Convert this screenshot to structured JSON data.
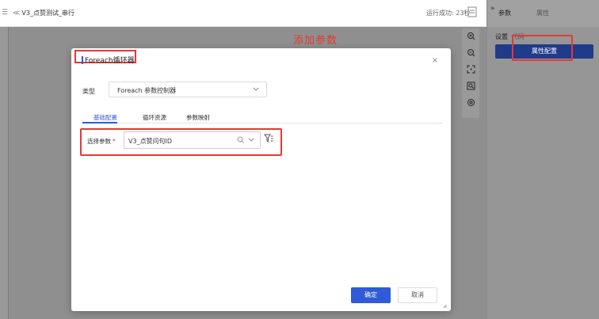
{
  "header": {
    "left_icon": "panel-icon",
    "back_symbol": "≪",
    "title": "V3_点赞测试_串行",
    "status": "运行成功: 23秒"
  },
  "annotation": {
    "text": "添加参数",
    "color": "#e53935"
  },
  "zoom_toolbar": {
    "icons": [
      "zoom-in-icon",
      "zoom-out-icon",
      "fit-screen-icon",
      "zoom-area-icon",
      "locate-icon"
    ]
  },
  "right_panel": {
    "collapse_symbol": "»",
    "tabs": [
      "参数",
      "属性"
    ],
    "setting_label": "设置",
    "setting_sub": " 代码",
    "button_label": "属性配置"
  },
  "dialog": {
    "title": "Foreach循环器",
    "close_symbol": "×",
    "type_label": "类型",
    "type_value": "Foreach 参数控制器",
    "tabs": [
      "基础配置",
      "循环资源",
      "参数映射"
    ],
    "active_tab": "基础配置",
    "param_label": "选择参数",
    "required_mark": "*",
    "param_value": "V3_点赞问句ID",
    "ok_label": "确定",
    "cancel_label": "取消"
  },
  "colors": {
    "accent": "#2f5bd8",
    "annotation_red": "#e53935",
    "overlay": "#8f8f8f"
  }
}
